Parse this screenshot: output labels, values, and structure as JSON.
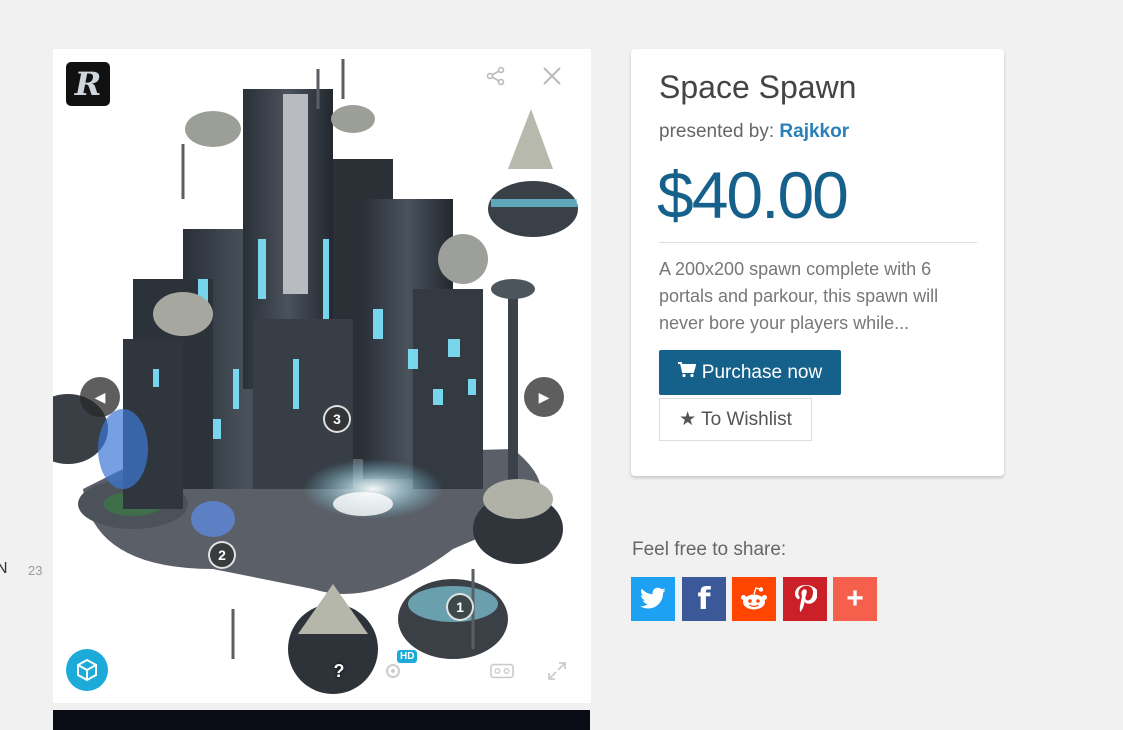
{
  "edge": {
    "text": "N",
    "number": "23"
  },
  "viewer": {
    "logo_letter": "R",
    "hotspots": [
      "3",
      "2",
      "1"
    ],
    "hd_badge": "HD",
    "help_label": "?",
    "icons": [
      "share-icon",
      "close-icon",
      "prev-arrow-icon",
      "next-arrow-icon",
      "sketchfab-logo-icon",
      "help-icon",
      "settings-icon",
      "layers-icon",
      "vr-icon",
      "fullscreen-icon"
    ]
  },
  "product": {
    "title": "Space Spawn",
    "presented_label": "presented by:",
    "author": "Rajkkor",
    "price": "$40.00",
    "description": "A 200x200 spawn complete with 6 portals and parkour, this spawn will never bore your players while...",
    "purchase_label": "Purchase now",
    "wishlist_label": "To Wishlist"
  },
  "share": {
    "label": "Feel free to share:",
    "buttons": [
      {
        "name": "twitter",
        "color": "#1da1f2"
      },
      {
        "name": "facebook",
        "color": "#3b5998"
      },
      {
        "name": "reddit",
        "color": "#ff4500"
      },
      {
        "name": "pinterest",
        "color": "#cb2027"
      },
      {
        "name": "more",
        "color": "#f4604c"
      }
    ]
  },
  "colors": {
    "accent": "#16618b",
    "author_link": "#2980b9",
    "sketchfab": "#1caad9"
  }
}
